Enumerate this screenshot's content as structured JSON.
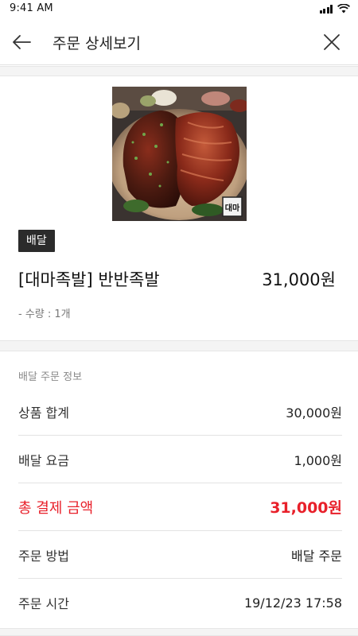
{
  "status_bar": {
    "time": "9:41 AM"
  },
  "header": {
    "title": "주문 상세보기"
  },
  "product": {
    "badge": "배달",
    "name": "[대마족발] 반반족발",
    "price": "31,000원",
    "quantity": "- 수량 : 1개",
    "image_logo_text": "대마"
  },
  "order_info": {
    "heading": "배달 주문 정보",
    "rows": [
      {
        "label": "상품 합계",
        "value": "30,000원"
      },
      {
        "label": "배달 요금",
        "value": "1,000원"
      },
      {
        "label": "총 결제 금액",
        "value": "31,000원"
      },
      {
        "label": "주문 방법",
        "value": "배달 주문"
      },
      {
        "label": "주문 시간",
        "value": "19/12/23 17:58"
      }
    ]
  },
  "colors": {
    "accent_red": "#e8202a",
    "badge_bg": "#2b2b2b",
    "divider": "#e3e3e3",
    "band": "#f4f4f4"
  }
}
